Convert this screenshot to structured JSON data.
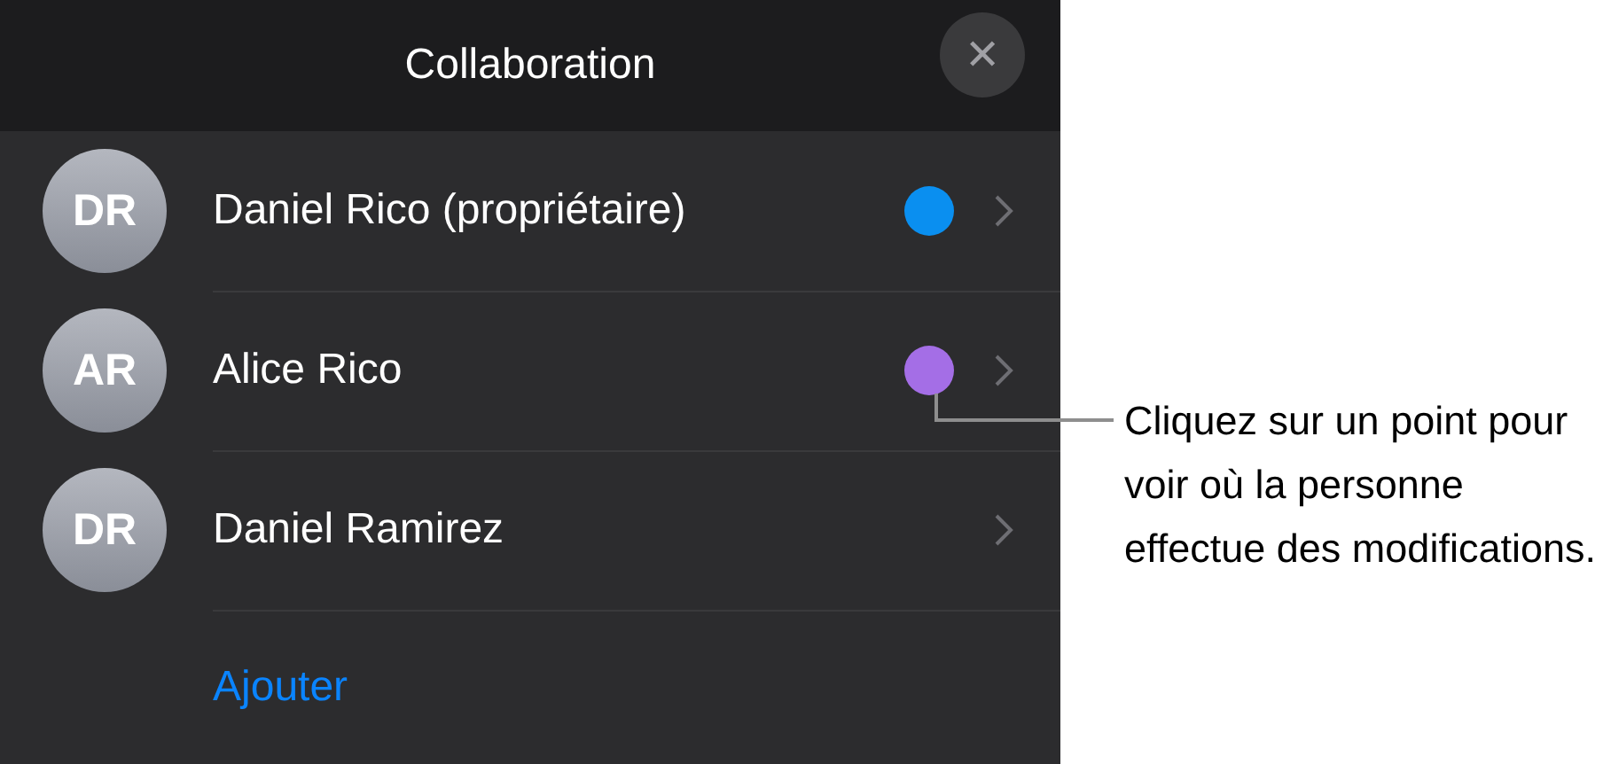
{
  "panel": {
    "title": "Collaboration",
    "close": "✕"
  },
  "people": [
    {
      "initials": "DR",
      "name": "Daniel Rico (propriétaire)",
      "color": "#0a8ff0"
    },
    {
      "initials": "AR",
      "name": "Alice Rico",
      "color": "#a46ee6"
    },
    {
      "initials": "DR",
      "name": "Daniel Ramirez"
    }
  ],
  "add_link": "Ajouter",
  "callout": "Cliquez sur un point pour voir où la personne effectue des modifications."
}
